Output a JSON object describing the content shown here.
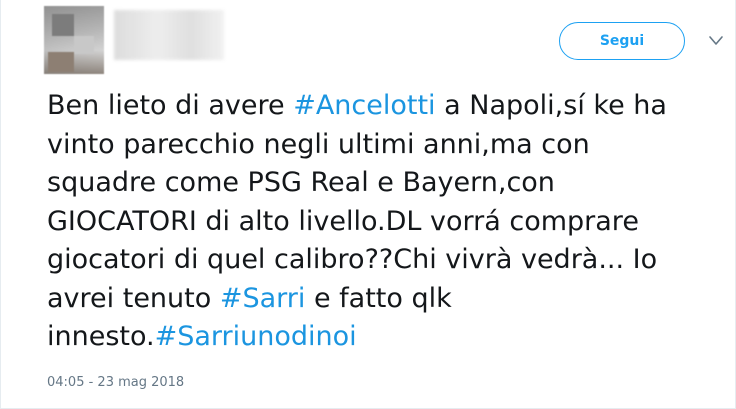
{
  "tweet": {
    "follow_label": "Segui",
    "lines": [
      {
        "pre": "Ben lieto di avere ",
        "tag": "#Ancelotti",
        "post": " a Napoli,sí ke ha"
      },
      {
        "text": "vinto parecchio negli ultimi anni,ma con"
      },
      {
        "text": "squadre come PSG Real e Bayern,con"
      },
      {
        "text": "GIOCATORI di alto livello.DL vorrá comprare"
      },
      {
        "text": "giocatori di quel calibro??Chi vivrà vedrà... Io"
      },
      {
        "pre": "avrei tenuto ",
        "tag": "#Sarri",
        "post": " e fatto qlk"
      },
      {
        "pre": "innesto.",
        "tag": "#Sarriunodinoi",
        "post": ""
      }
    ],
    "timestamp": "04:05 - 23 mag 2018"
  },
  "icons": {
    "menu": "chevron-down-icon"
  },
  "colors": {
    "accent": "#1da1f2",
    "hashtag": "#1b95e0",
    "text": "#14171a",
    "meta": "#657786"
  }
}
